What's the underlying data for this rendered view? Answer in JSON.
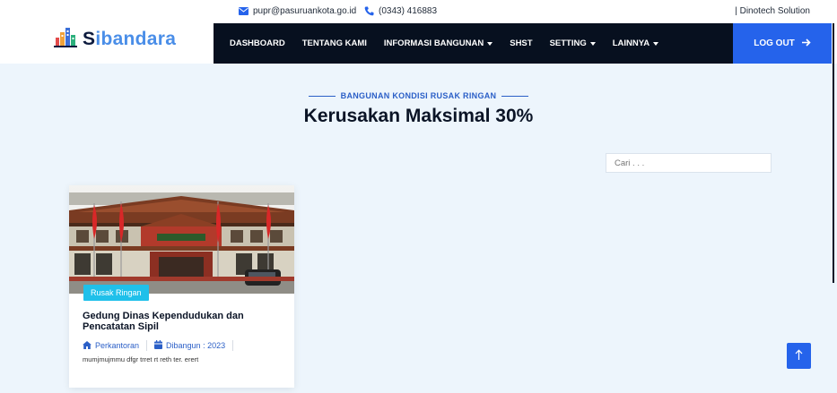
{
  "topbar": {
    "email": "pupr@pasuruankota.go.id",
    "phone": "(0343) 416883",
    "credit": "| Dinotech Solution"
  },
  "header": {
    "logo_first": "S",
    "logo_rest": "ibandara",
    "nav": [
      {
        "label": "DASHBOARD",
        "dropdown": false
      },
      {
        "label": "TENTANG KAMI",
        "dropdown": false
      },
      {
        "label": "INFORMASI BANGUNAN",
        "dropdown": true
      },
      {
        "label": "SHST",
        "dropdown": false
      },
      {
        "label": "SETTING",
        "dropdown": true
      },
      {
        "label": "LAINNYA",
        "dropdown": true
      }
    ],
    "logout_label": "LOG OUT"
  },
  "section": {
    "subtitle": "BANGUNAN KONDISI RUSAK RINGAN",
    "title": "Kerusakan Maksimal 30%"
  },
  "search": {
    "placeholder": "Cari . . ."
  },
  "card": {
    "badge": "Rusak Ringan",
    "title": "Gedung Dinas Kependudukan dan Pencatatan Sipil",
    "category": "Perkantoran",
    "built": "Dibangun : 2023",
    "description": "mumjmujmmu dfgr trret rt reth ter. erert"
  },
  "colors": {
    "accent": "#2563eb",
    "nav_bg": "#07101f",
    "badge": "#1fc0ea",
    "page_bg": "#edf5fc"
  },
  "icons": {
    "email": "envelope-icon",
    "phone": "phone-icon",
    "logout": "arrow-right-icon",
    "category": "home-icon",
    "built": "calendar-icon",
    "back_to_top": "arrow-up-icon"
  }
}
